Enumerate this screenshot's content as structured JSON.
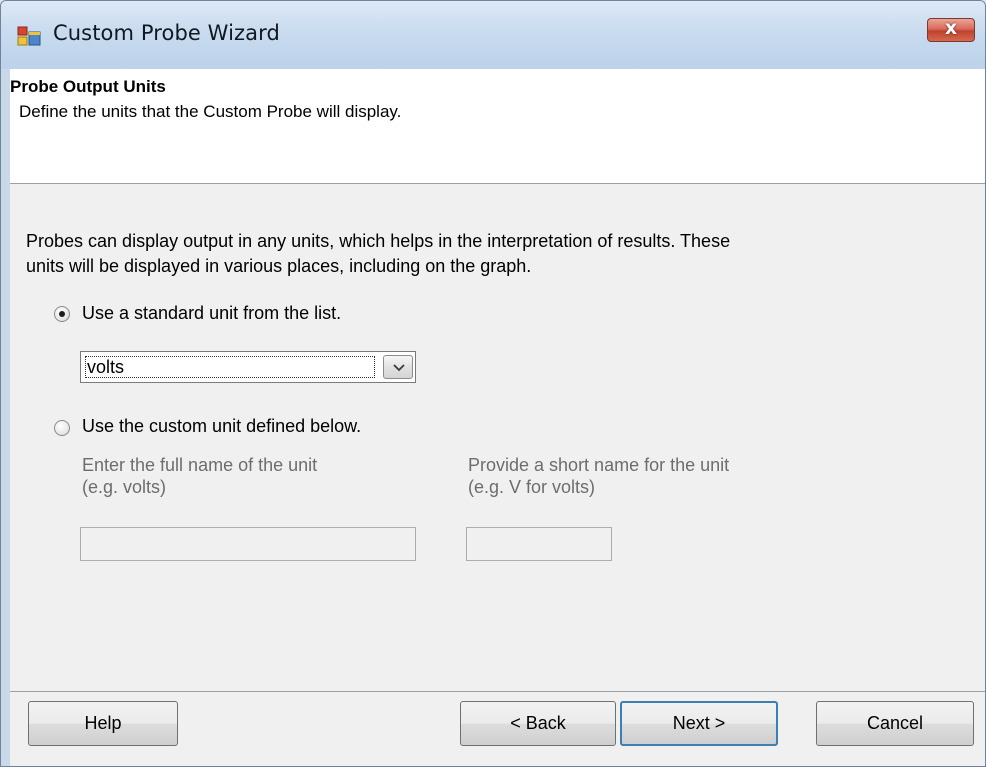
{
  "window": {
    "title": "Custom Probe Wizard",
    "close_glyph": "x"
  },
  "header": {
    "title": "Probe Output Units",
    "subtitle": "Define the units that the Custom Probe will display."
  },
  "body": {
    "intro_line1": "Probes can display output in any units, which helps in the interpretation of results. These",
    "intro_line2": "units will be displayed in various places, including on the graph.",
    "standard_option": {
      "label": "Use a standard unit from the list.",
      "selected": true,
      "combo_value": "volts"
    },
    "custom_option": {
      "label": "Use the custom unit defined below.",
      "selected": false,
      "full_name_label_line1": "Enter the full name of the unit",
      "full_name_label_line2": "(e.g. volts)",
      "full_name_value": "",
      "short_name_label_line1": "Provide a short name for the unit",
      "short_name_label_line2": "(e.g. V for volts)",
      "short_name_value": ""
    }
  },
  "buttons": {
    "help": "Help",
    "back": "< Back",
    "next": "Next >",
    "cancel": "Cancel"
  },
  "colors": {
    "titlebar": "#c9dbef",
    "close_button": "#c0432f",
    "dialog_background": "#f0f0f0",
    "header_background": "#ffffff",
    "default_button_border": "#3c7fb1"
  },
  "icons": {
    "app": "window-app-icon",
    "close": "close-icon",
    "dropdown": "chevron-down-icon"
  }
}
